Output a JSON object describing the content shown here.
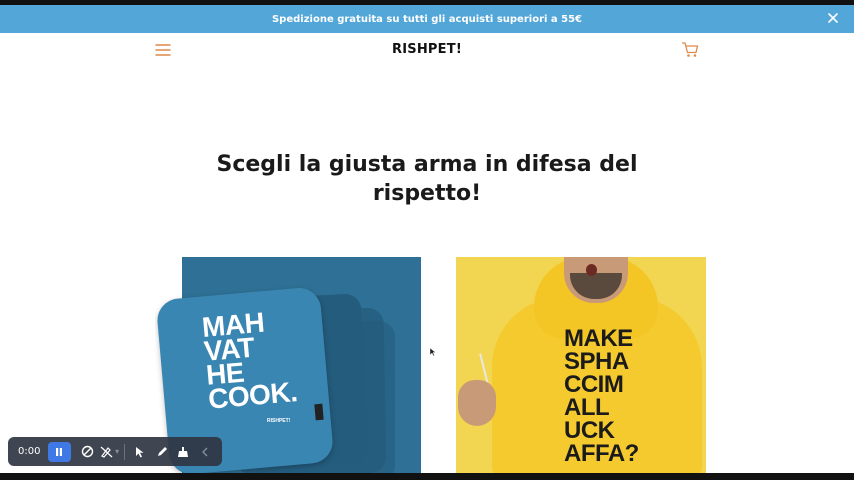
{
  "announcement": {
    "text": "Spedizione gratuita su tutti gli acquisti superiori a 55€",
    "close_icon": "close-icon",
    "background": "#52a6d8"
  },
  "header": {
    "logo": "RISHPET!",
    "menu_icon": "hamburger-menu-icon",
    "cart_icon": "cart-icon",
    "accent_color": "#e0894a"
  },
  "hero": {
    "title": "Scegli la giusta arma in difesa del rispetto!"
  },
  "products": [
    {
      "image_lines": [
        "MAH",
        "VAT",
        "HE",
        "COOK."
      ],
      "brand_mark": "RISHPET!"
    },
    {
      "image_lines": [
        "MAKE",
        "SPHA",
        "CCIM",
        "ALL",
        "UCK",
        "AFFA?"
      ]
    }
  ],
  "recorder": {
    "time": "0:00",
    "icons": [
      "pause-icon",
      "hide-drawing-icon",
      "drawing-visibility-icon",
      "cursor-tool-icon",
      "pen-tool-icon",
      "clear-drawing-icon",
      "collapse-icon"
    ],
    "accent": "#3f79e6"
  }
}
